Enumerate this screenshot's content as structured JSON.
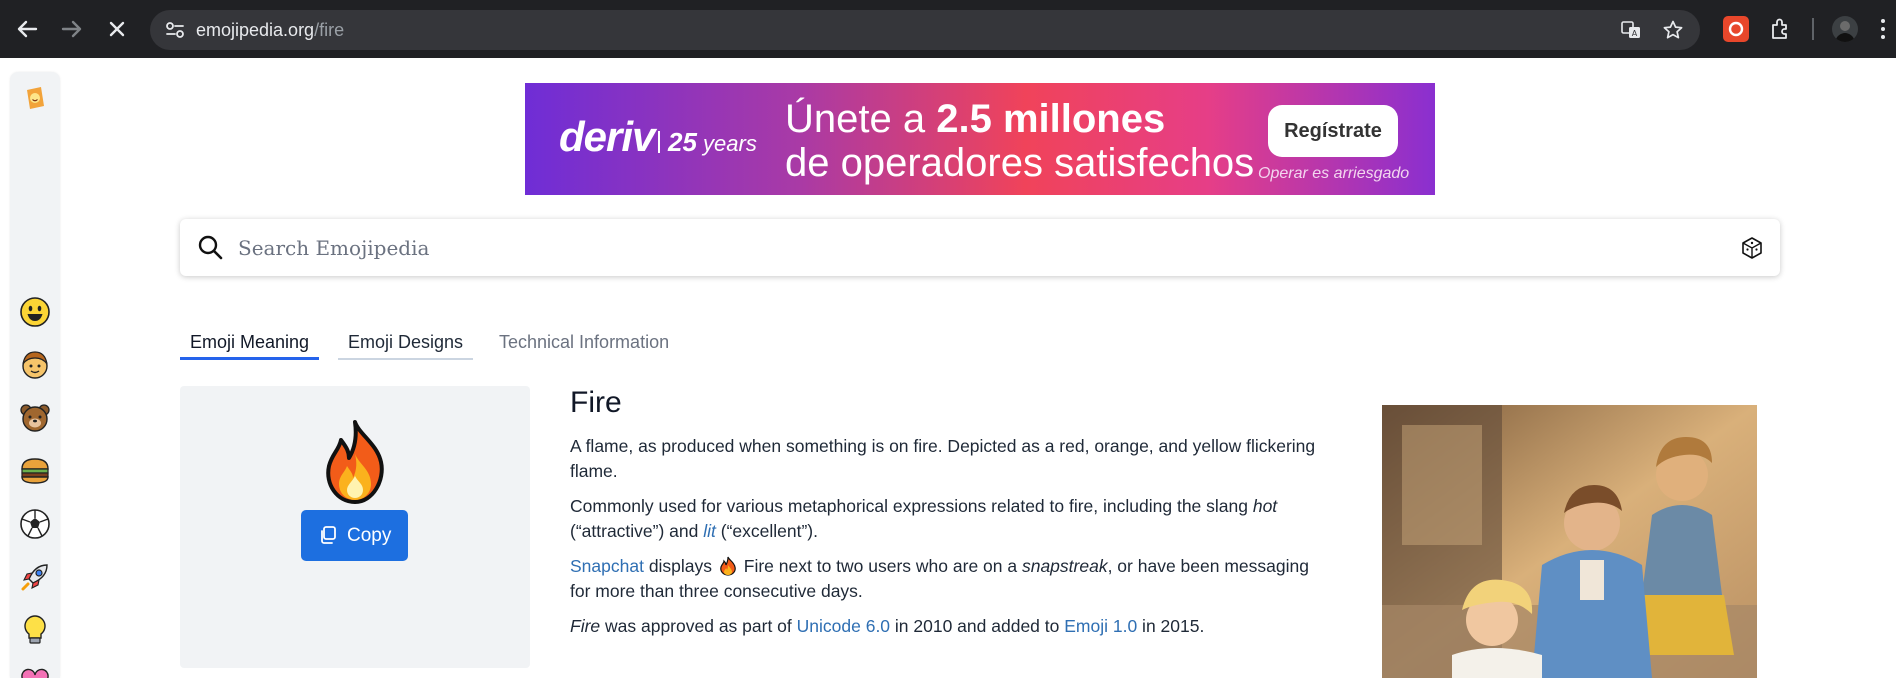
{
  "browser": {
    "url_domain": "emojipedia.org",
    "url_path": "/fire",
    "back_icon": "back-arrow-icon",
    "forward_icon": "forward-arrow-icon",
    "stop_icon": "close-icon"
  },
  "sidebar": {
    "items": [
      {
        "name": "smileys",
        "glyph": "😃"
      },
      {
        "name": "people",
        "glyph": "🧒"
      },
      {
        "name": "animals",
        "glyph": "🐻"
      },
      {
        "name": "food",
        "glyph": "🍔"
      },
      {
        "name": "activities",
        "glyph": "⚽"
      },
      {
        "name": "travel",
        "glyph": "🚀"
      },
      {
        "name": "objects",
        "glyph": "💡"
      }
    ]
  },
  "ad": {
    "brand": "deriv",
    "years_num": "25",
    "years_word": "years",
    "line1_pre": "Únete a ",
    "line1_bold": "2.5 millones",
    "line2": "de operadores satisfechos",
    "cta": "Regístrate",
    "fine": "Operar es arriesgado"
  },
  "search": {
    "placeholder": "Search Emojipedia"
  },
  "tabs": {
    "meaning": "Emoji Meaning",
    "designs": "Emoji Designs",
    "technical": "Technical Information"
  },
  "card": {
    "copy_label": "Copy"
  },
  "content": {
    "title": "Fire",
    "p1": "A flame, as produced when something is on fire. Depicted as a red, orange, and yellow flickering flame.",
    "p2_a": "Commonly used for various metaphorical expressions related to fire, including the slang ",
    "p2_hot": "hot",
    "p2_b": " (“attractive”) and ",
    "p2_lit": "lit",
    "p2_c": " (“excellent”).",
    "p3_link": "Snapchat",
    "p3_a": " displays ",
    "p3_b": " Fire next to two users who are on a ",
    "p3_snap": "snapstreak",
    "p3_c": ", or have been messaging for more than three consecutive days.",
    "p4_fire": "Fire",
    "p4_a": " was approved as part of ",
    "p4_unicode": "Unicode 6.0",
    "p4_b": " in 2010 and added to ",
    "p4_emoji": "Emoji 1.0",
    "p4_c": " in 2015."
  },
  "colors": {
    "accent": "#1d6fe0",
    "link": "#2f6fb3",
    "chrome": "#202124"
  }
}
